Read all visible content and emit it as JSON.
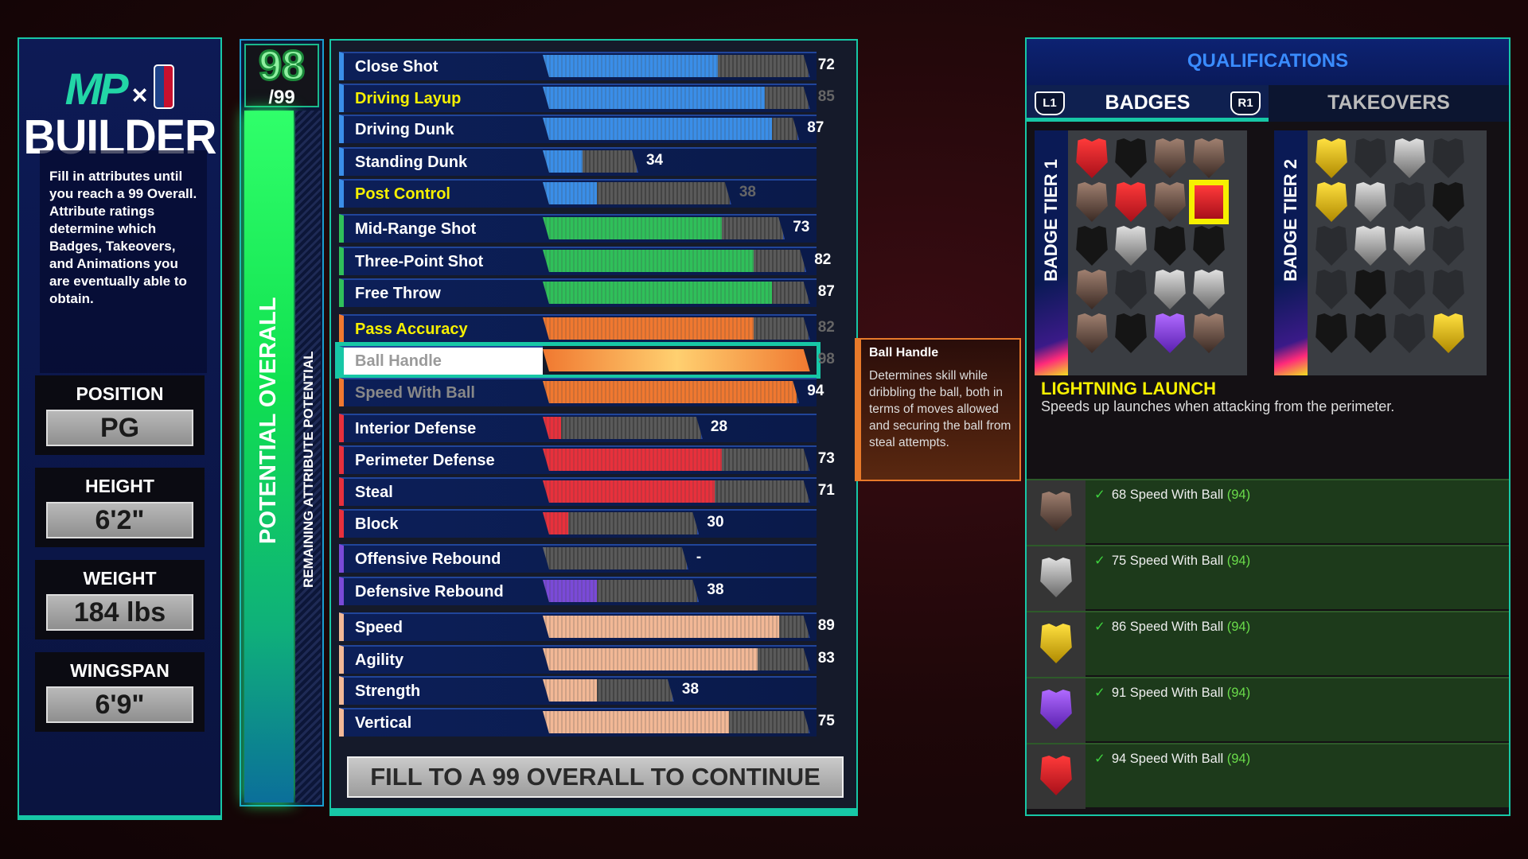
{
  "builder": {
    "logo_text": "MP",
    "logo_x": "×",
    "title": "BUILDER",
    "description": "Fill in attributes until you reach a 99 Overall. Attribute ratings determine which Badges, Takeovers, and Animations you are eventually able to obtain."
  },
  "physicals": [
    {
      "label": "POSITION",
      "value": "PG"
    },
    {
      "label": "HEIGHT",
      "value": "6'2\""
    },
    {
      "label": "WEIGHT",
      "value": "184 lbs"
    },
    {
      "label": "WINGSPAN",
      "value": "6'9\""
    }
  ],
  "overall": {
    "value": "98",
    "max": "/99",
    "label": "POTENTIAL OVERALL",
    "sublabel": "REMAINING ATTRIBUTE POTENTIAL",
    "fill_percent": 99
  },
  "colors": {
    "inside": "#3a8ee8",
    "shooting": "#2fc05a",
    "playmaking": "#f07830",
    "defense": "#e8303c",
    "rebounding": "#7a4ad8",
    "physicals": "#f2b896",
    "accent": "#17c7a6"
  },
  "attributes": [
    {
      "name": "Close Shot",
      "value": "72",
      "cap": 99,
      "group": "inside"
    },
    {
      "name": "Driving Layup",
      "value": "85",
      "cap": 99,
      "group": "inside",
      "highlight": true
    },
    {
      "name": "Driving Dunk",
      "value": "87",
      "cap": 96,
      "group": "inside"
    },
    {
      "name": "Standing Dunk",
      "value": "34",
      "cap": 51,
      "group": "inside"
    },
    {
      "name": "Post Control",
      "value": "38",
      "cap": 77,
      "group": "inside",
      "highlight": true
    },
    {
      "name": "Mid-Range Shot",
      "value": "73",
      "cap": 92,
      "group": "shooting"
    },
    {
      "name": "Three-Point Shot",
      "value": "82",
      "cap": 98,
      "group": "shooting"
    },
    {
      "name": "Free Throw",
      "value": "87",
      "cap": 99,
      "group": "shooting"
    },
    {
      "name": "Pass Accuracy",
      "value": "82",
      "cap": 99,
      "group": "playmaking",
      "highlight": true
    },
    {
      "name": "Ball Handle",
      "value": "98",
      "cap": 99,
      "group": "playmaking",
      "selected": true
    },
    {
      "name": "Speed With Ball",
      "value": "94",
      "cap": 96,
      "group": "playmaking",
      "dim": true
    },
    {
      "name": "Interior Defense",
      "value": "28",
      "cap": 69,
      "group": "defense"
    },
    {
      "name": "Perimeter Defense",
      "value": "73",
      "cap": 99,
      "group": "defense"
    },
    {
      "name": "Steal",
      "value": "71",
      "cap": 99,
      "group": "defense"
    },
    {
      "name": "Block",
      "value": "30",
      "cap": 68,
      "group": "defense"
    },
    {
      "name": "Offensive Rebound",
      "value": "-",
      "cap": 65,
      "group": "rebounding"
    },
    {
      "name": "Defensive Rebound",
      "value": "38",
      "cap": 68,
      "group": "rebounding"
    },
    {
      "name": "Speed",
      "value": "89",
      "cap": 99,
      "group": "physicals"
    },
    {
      "name": "Agility",
      "value": "83",
      "cap": 99,
      "group": "physicals"
    },
    {
      "name": "Strength",
      "value": "38",
      "cap": 61,
      "group": "physicals"
    },
    {
      "name": "Vertical",
      "value": "75",
      "cap": 99,
      "group": "physicals"
    }
  ],
  "continue_button": "FILL TO A 99 OVERALL TO CONTINUE",
  "tooltip": {
    "title": "Ball Handle",
    "text": "Determines skill while dribbling the ball, both in terms of moves allowed and securing the ball from steal attempts."
  },
  "qualifications": {
    "title": "QUALIFICATIONS",
    "tabs": [
      {
        "label": "BADGES",
        "active": true
      },
      {
        "label": "TAKEOVERS"
      }
    ],
    "left_key": "L1",
    "right_key": "R1",
    "tier1": {
      "label": "BADGE TIER 1",
      "badges": [
        "legend",
        "locked",
        "bronze",
        "bronze",
        "bronze",
        "legend",
        "bronze",
        "legend-selected",
        "locked",
        "silver",
        "locked",
        "locked",
        "bronze",
        "empty",
        "silver",
        "silver",
        "bronze",
        "locked",
        "hof",
        "bronze"
      ]
    },
    "tier2": {
      "label": "BADGE TIER 2",
      "badges": [
        "gold",
        "empty",
        "silver",
        "empty",
        "gold",
        "silver",
        "empty",
        "locked",
        "empty",
        "silver",
        "silver",
        "empty",
        "empty",
        "locked",
        "empty",
        "empty",
        "locked",
        "locked",
        "empty",
        "gold"
      ]
    },
    "selected_badge": {
      "name": "LIGHTNING LAUNCH",
      "description": "Speeds up launches when attacking from the perimeter."
    },
    "requirements": [
      {
        "level": "bronze",
        "check": "✓",
        "text": "68 Speed With Ball",
        "current": "(94)"
      },
      {
        "level": "silver",
        "check": "✓",
        "text": "75 Speed With Ball",
        "current": "(94)"
      },
      {
        "level": "gold",
        "check": "✓",
        "text": "86 Speed With Ball",
        "current": "(94)"
      },
      {
        "level": "hof",
        "check": "✓",
        "text": "91 Speed With Ball",
        "current": "(94)"
      },
      {
        "level": "legend",
        "check": "✓",
        "text": "94 Speed With Ball",
        "current": "(94)"
      }
    ]
  }
}
